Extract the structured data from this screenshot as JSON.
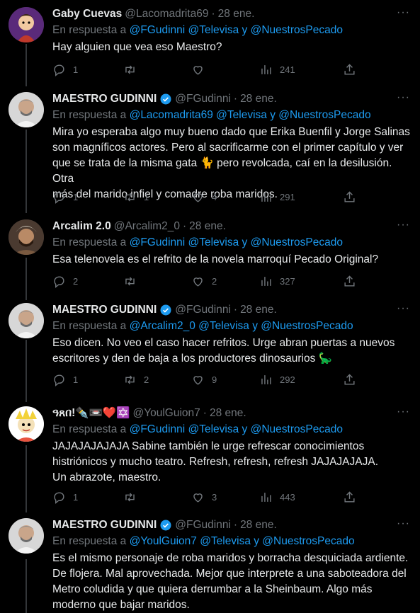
{
  "tweets": [
    {
      "name": "Gaby Cuevas",
      "verified": false,
      "handle": "@Lacomadrita69",
      "date": "28 ene.",
      "reply_prefix": "En respuesta a",
      "reply_to": "@FGudinni @Televisa y @NuestrosPecado",
      "text": "Hay alguien que vea eso Maestro?",
      "replies": "1",
      "retweets": "",
      "likes": "",
      "views": "241"
    },
    {
      "name": "MAESTRO GUDINNI",
      "verified": true,
      "handle": "@FGudinni",
      "date": "28 ene.",
      "reply_prefix": "En respuesta a",
      "reply_to": "@Lacomadrita69 @Televisa y @NuestrosPecado",
      "text": "Mira yo esperaba algo muy bueno dado que Erika Buenfil y Jorge Salinas\nson magníficos actores. Pero al sacrificarme con el primer capítulo y ver\nque se trata de la misma gata 🐈 pero revolcada, caí en la desilusión. Otra\nmás del marido infiel y comadre roba maridos.",
      "replies": "1",
      "retweets": "1",
      "likes": "4",
      "views": "291"
    },
    {
      "name": "Arcalim 2.0",
      "verified": false,
      "handle": "@Arcalim2_0",
      "date": "28 ene.",
      "reply_prefix": "En respuesta a",
      "reply_to": "@FGudinni @Televisa y @NuestrosPecado",
      "text": "Esa telenovela es el refrito de la novela marroquí Pecado Original?",
      "replies": "2",
      "retweets": "",
      "likes": "2",
      "views": "327"
    },
    {
      "name": "MAESTRO GUDINNI",
      "verified": true,
      "handle": "@FGudinni",
      "date": "28 ene.",
      "reply_prefix": "En respuesta a",
      "reply_to": "@Arcalim2_0 @Televisa y @NuestrosPecado",
      "text": "Eso dicen. No veo el caso hacer refritos. Urge abran puertas a nuevos\nescritores y den de baja a los productores dinosaurios 🦕",
      "replies": "1",
      "retweets": "2",
      "likes": "9",
      "views": "292"
    },
    {
      "name": "ዓጸበ!✒️📼❤️✡️",
      "verified": false,
      "handle": "@YoulGuion7",
      "date": "28 ene.",
      "reply_prefix": "En respuesta a",
      "reply_to": "@FGudinni @Televisa y @NuestrosPecado",
      "text": "JAJAJAJAJAJA Sabine también le urge refrescar conocimientos\nhistriónicos y mucho teatro. Refresh, refresh, refresh JAJAJAJAJA.\nUn abrazote, maestro.",
      "replies": "1",
      "retweets": "",
      "likes": "3",
      "views": "443"
    },
    {
      "name": "MAESTRO GUDINNI",
      "verified": true,
      "handle": "@FGudinni",
      "date": "28 ene.",
      "reply_prefix": "En respuesta a",
      "reply_to": "@YoulGuion7 @Televisa y @NuestrosPecado",
      "text": "Es el mismo personaje de roba maridos y borracha desquiciada ardiente.\nDe flojera. Mal aprovechada. Mejor que interprete a una saboteadora del\nMetro coludida y que quiera derrumbar a la Sheinbaum. Algo más\nmoderno que bajar maridos.",
      "replies": "",
      "retweets": "",
      "likes": "",
      "views": ""
    }
  ],
  "colors": {
    "background": "#000000",
    "text": "#e7e9ea",
    "muted": "#71767b",
    "link": "#1d9bf0",
    "verified": "#1d9bf0"
  },
  "icons": [
    "reply-icon",
    "retweet-icon",
    "like-icon",
    "views-icon",
    "share-icon",
    "more-icon",
    "verified-icon"
  ]
}
